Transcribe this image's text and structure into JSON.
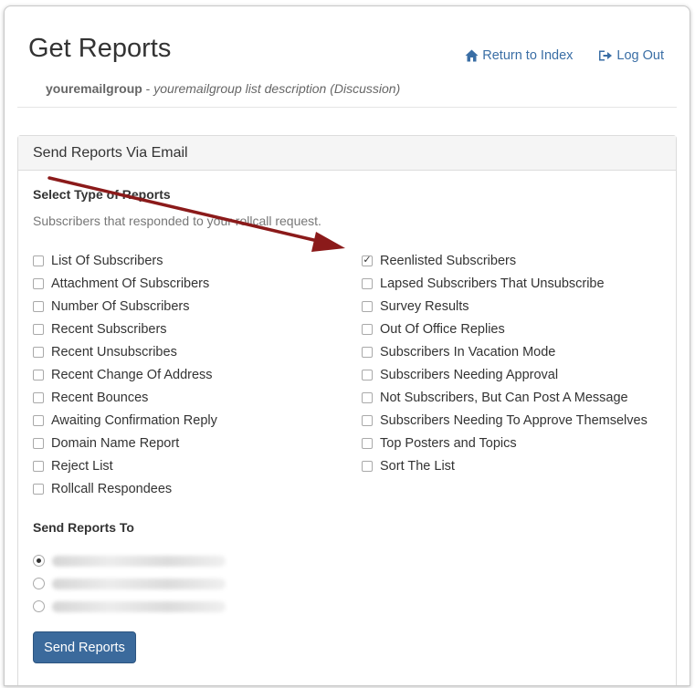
{
  "header": {
    "title": "Get Reports",
    "group_name": "youremailgroup",
    "separator": " - ",
    "group_description": "youremailgroup list description (Discussion)",
    "return_label": "Return to Index",
    "logout_label": "Log Out"
  },
  "panel": {
    "heading": "Send Reports Via Email",
    "select_type_label": "Select Type of Reports",
    "help_text": "Subscribers that responded to your rollcall request.",
    "left_options": [
      {
        "label": "List Of Subscribers",
        "checked": false
      },
      {
        "label": "Attachment Of Subscribers",
        "checked": false
      },
      {
        "label": "Number Of Subscribers",
        "checked": false
      },
      {
        "label": "Recent Subscribers",
        "checked": false
      },
      {
        "label": "Recent Unsubscribes",
        "checked": false
      },
      {
        "label": "Recent Change Of Address",
        "checked": false
      },
      {
        "label": "Recent Bounces",
        "checked": false
      },
      {
        "label": "Awaiting Confirmation Reply",
        "checked": false
      },
      {
        "label": "Domain Name Report",
        "checked": false
      },
      {
        "label": "Reject List",
        "checked": false
      },
      {
        "label": "Rollcall Respondees",
        "checked": false
      }
    ],
    "right_options": [
      {
        "label": "Reenlisted Subscribers",
        "checked": true
      },
      {
        "label": "Lapsed Subscribers That Unsubscribe",
        "checked": false
      },
      {
        "label": "Survey Results",
        "checked": false
      },
      {
        "label": "Out Of Office Replies",
        "checked": false
      },
      {
        "label": "Subscribers In Vacation Mode",
        "checked": false
      },
      {
        "label": "Subscribers Needing Approval",
        "checked": false
      },
      {
        "label": "Not Subscribers, But Can Post A Message",
        "checked": false
      },
      {
        "label": "Subscribers Needing To Approve Themselves",
        "checked": false
      },
      {
        "label": "Top Posters and Topics",
        "checked": false
      },
      {
        "label": "Sort The List",
        "checked": false
      }
    ],
    "send_to_label": "Send Reports To",
    "recipients": [
      {
        "selected": true
      },
      {
        "selected": false
      },
      {
        "selected": false
      }
    ],
    "send_button": "Send Reports"
  },
  "colors": {
    "link": "#3a6ea5",
    "button": "#3b6a9c",
    "annotation_arrow": "#8b1a1a"
  }
}
